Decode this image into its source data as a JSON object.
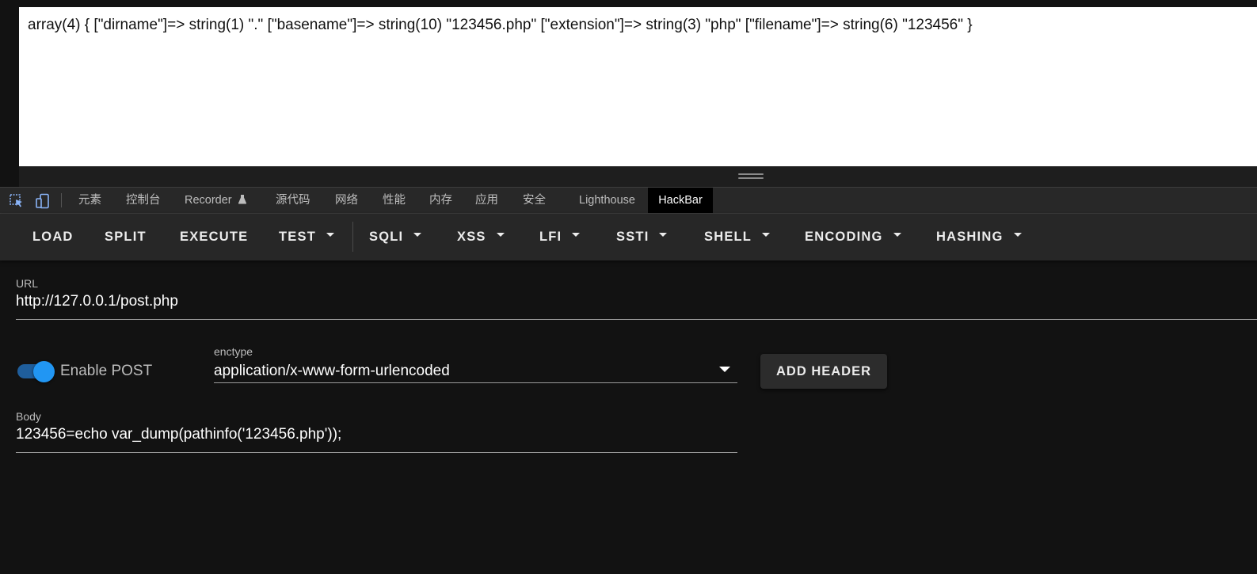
{
  "page_output": "array(4) { [\"dirname\"]=> string(1) \".\" [\"basename\"]=> string(10) \"123456.php\" [\"extension\"]=> string(3) \"php\" [\"filename\"]=> string(6) \"123456\" }",
  "devtools": {
    "icons": [
      "inspect-element-icon",
      "device-toolbar-icon",
      "flask-icon"
    ],
    "tabs": [
      "元素",
      "控制台",
      "Recorder",
      "源代码",
      "网络",
      "性能",
      "内存",
      "应用",
      "安全",
      "Lighthouse",
      "HackBar"
    ],
    "active_tab": "HackBar"
  },
  "hackbar": {
    "toolbar": {
      "load": "LOAD",
      "split": "SPLIT",
      "execute": "EXECUTE",
      "test": "TEST",
      "sqli": "SQLI",
      "xss": "XSS",
      "lfi": "LFI",
      "ssti": "SSTI",
      "shell": "SHELL",
      "encoding": "ENCODING",
      "hashing": "HASHING"
    },
    "url": {
      "label": "URL",
      "value": "http://127.0.0.1/post.php"
    },
    "post": {
      "label": "Enable POST",
      "enabled": true
    },
    "enctype": {
      "label": "enctype",
      "value": "application/x-www-form-urlencoded"
    },
    "add_header": "ADD HEADER",
    "body": {
      "label": "Body",
      "value": "123456=echo var_dump(pathinfo('123456.php'));"
    }
  },
  "colors": {
    "accent": "#2196f3",
    "panel_bg": "#121212",
    "toolbar_bg": "#272727"
  }
}
